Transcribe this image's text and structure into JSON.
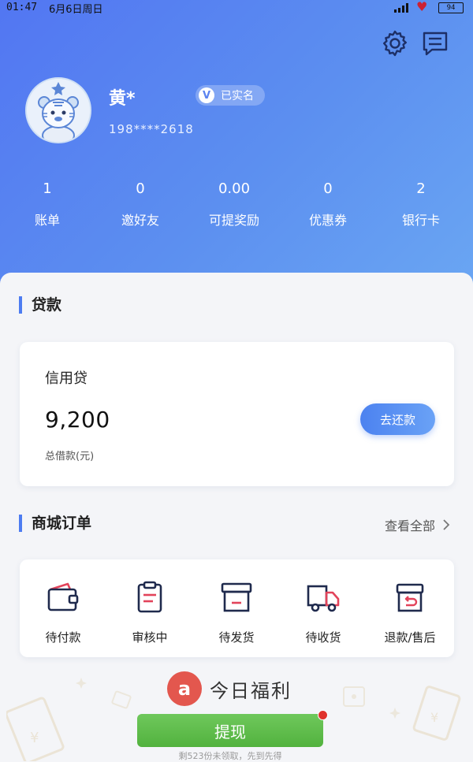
{
  "status_bar": {
    "time": "01:47",
    "date": "6月6日周日",
    "battery": "94",
    "icons": [
      "signal-icon",
      "heart-icon",
      "battery-icon"
    ]
  },
  "header": {
    "icons": [
      "gear-icon",
      "message-icon"
    ],
    "user": {
      "name": "黄*",
      "verified_mark": "V",
      "verified_label": "已实名",
      "phone": "198****2618"
    },
    "stats": [
      {
        "value": "1",
        "label": "账单"
      },
      {
        "value": "0",
        "label": "邀好友"
      },
      {
        "value": "0.00",
        "label": "可提奖励"
      },
      {
        "value": "0",
        "label": "优惠券"
      },
      {
        "value": "2",
        "label": "银行卡"
      }
    ]
  },
  "loan": {
    "section_title": "贷款",
    "type": "信用贷",
    "amount": "9,200",
    "caption": "总借款(元)",
    "repay_label": "去还款"
  },
  "orders": {
    "section_title": "商城订单",
    "view_all": "查看全部",
    "items": [
      {
        "label": "待付款",
        "icon": "wallet-icon"
      },
      {
        "label": "审核中",
        "icon": "clipboard-icon"
      },
      {
        "label": "待发货",
        "icon": "box-icon"
      },
      {
        "label": "待收货",
        "icon": "truck-icon"
      },
      {
        "label": "退款/售后",
        "icon": "return-icon"
      }
    ]
  },
  "promo": {
    "logo_letter": "a",
    "title": "今日福利",
    "button_label": "提现",
    "subtitle": "剩523份未领取，先到先得"
  },
  "colors": {
    "accent": "#4d7cf1",
    "header_gradient_start": "#5276f2",
    "header_gradient_end": "#6aa6f3",
    "icon_red": "#e2435a",
    "icon_navy": "#1f2a4d",
    "withdraw_green": "#52b23e"
  }
}
